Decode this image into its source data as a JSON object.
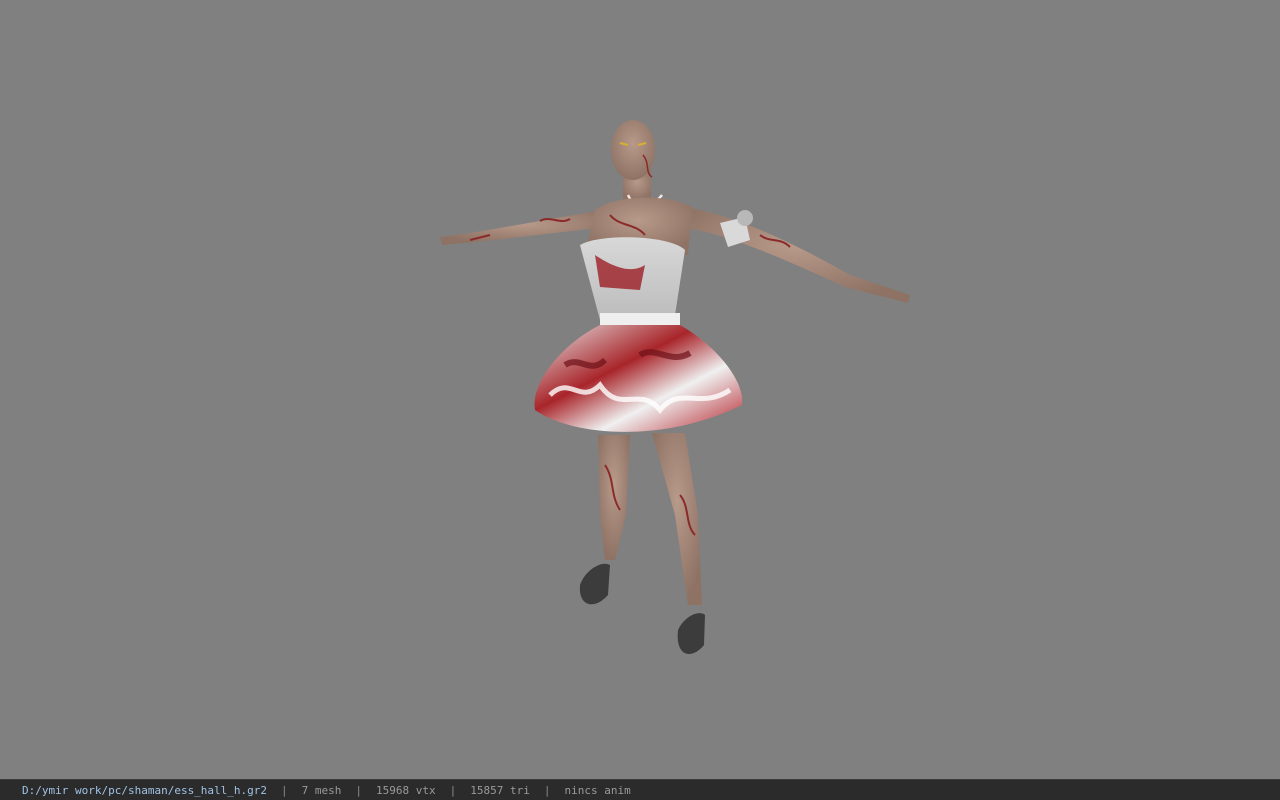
{
  "viewer": {
    "background_color": "#808080",
    "model_icon": "character-model-tpose"
  },
  "status": {
    "file_path": "D:/ymir work/pc/shaman/ess_hall_h.gr2",
    "mesh": "7 mesh",
    "vtx": "15968 vtx",
    "tri": "15857 tri",
    "anim": "nincs anim",
    "separator": "|"
  }
}
